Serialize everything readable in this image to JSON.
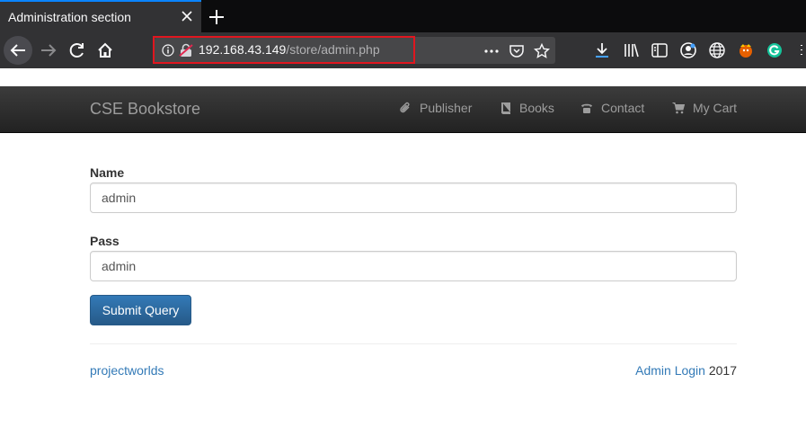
{
  "browser": {
    "tab_title": "Administration section",
    "url_host": "192.168.43.149",
    "url_path": "/store/admin.php"
  },
  "site": {
    "brand": "CSE Bookstore",
    "menu": [
      {
        "label": "Publisher",
        "icon": "paperclip-icon"
      },
      {
        "label": "Books",
        "icon": "book-icon"
      },
      {
        "label": "Contact",
        "icon": "phone-icon"
      },
      {
        "label": "My Cart",
        "icon": "cart-icon"
      }
    ]
  },
  "form": {
    "name_label": "Name",
    "name_value": "admin",
    "pass_label": "Pass",
    "pass_value": "admin",
    "submit_label": "Submit Query"
  },
  "footer": {
    "left_link": "projectworlds",
    "right_link": "Admin Login",
    "year": "2017"
  },
  "colors": {
    "brand_blue": "#337ab7",
    "url_highlight": "#e0161f"
  }
}
